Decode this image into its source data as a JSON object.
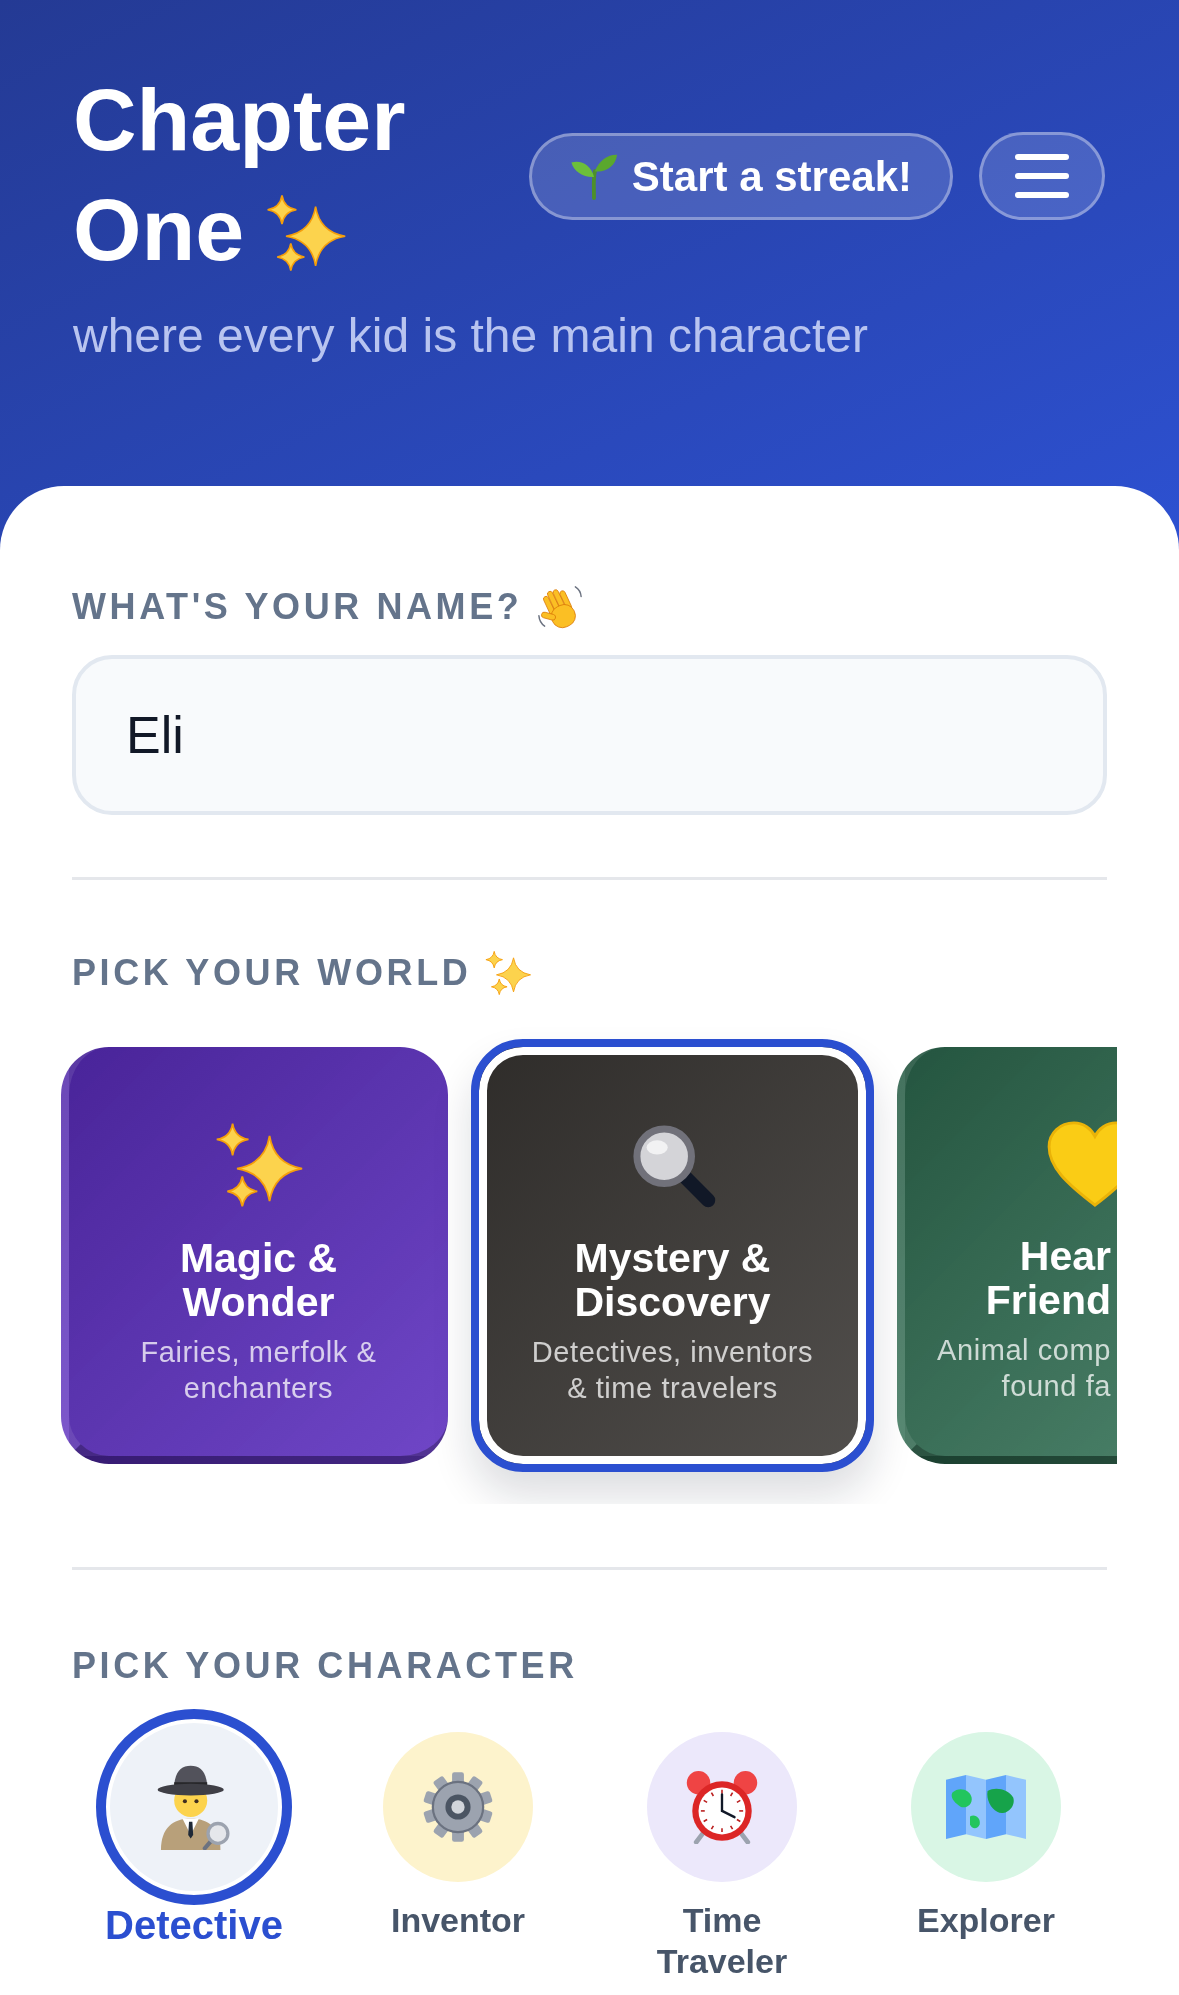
{
  "header": {
    "title_lines": [
      "Chapter",
      "One"
    ],
    "tagline": "where every kid is the main character",
    "streak_button": {
      "label": "Start a streak!"
    }
  },
  "name_section": {
    "label": "WHAT'S YOUR NAME?",
    "field": {
      "value": "Eli"
    }
  },
  "world_section": {
    "label": "PICK YOUR WORLD",
    "worlds": [
      {
        "title": "Magic &\nWonder",
        "description": "Fairies, merfolk &\nenchanters",
        "color": "#5b2dbf",
        "selected": false
      },
      {
        "title": "Mystery &\nDiscovery",
        "description": "Detectives, inventors\n& time travelers",
        "color": "#3a3734",
        "selected": true
      },
      {
        "title": "Hear\nFriend",
        "description": "Animal comp\nfound fa",
        "color": "#2d6a4f",
        "selected": false
      }
    ]
  },
  "character_section": {
    "label": "PICK YOUR CHARACTER",
    "characters": [
      {
        "label": "Detective",
        "color": "#eef2f8",
        "selected": true
      },
      {
        "label": "Inventor",
        "color": "#fdf3cc",
        "selected": false
      },
      {
        "label": "Time Traveler",
        "color": "#ece8fb",
        "selected": false
      },
      {
        "label": "Explorer",
        "color": "#d9f6e5",
        "selected": false
      }
    ]
  }
}
